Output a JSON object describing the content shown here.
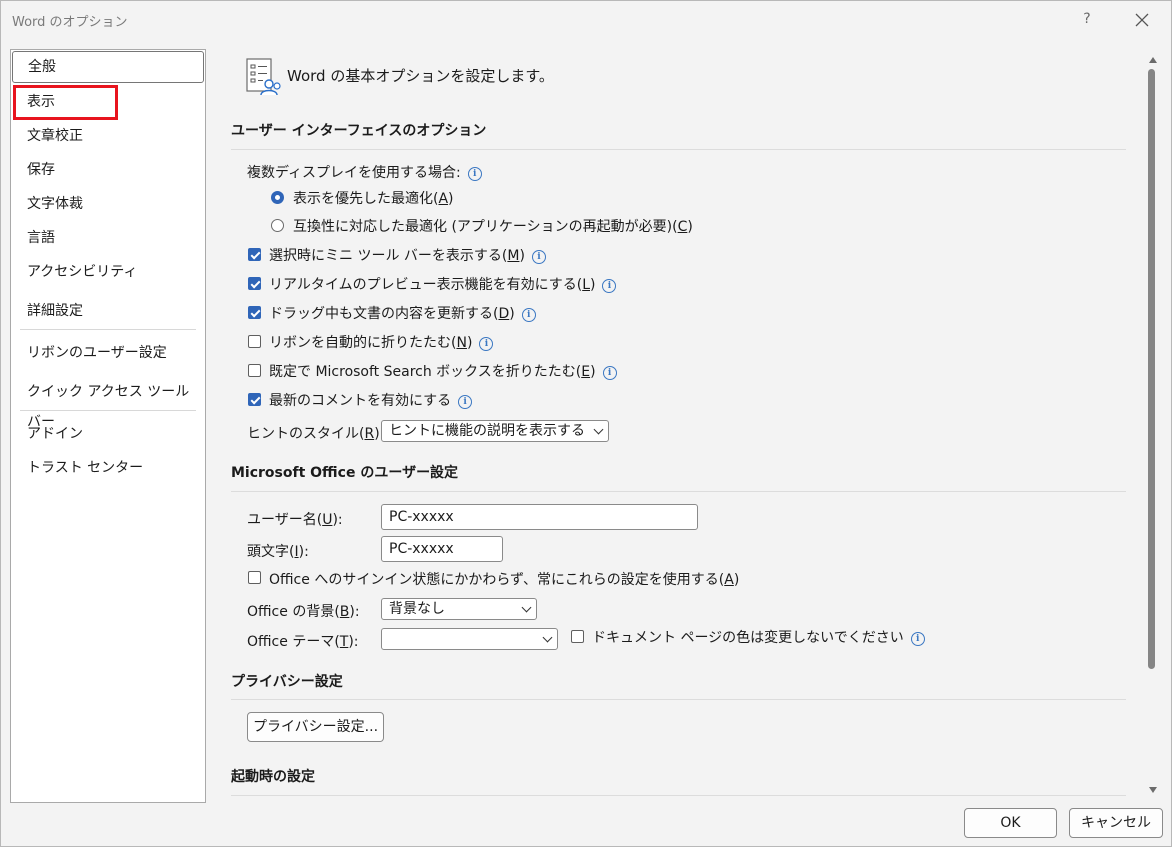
{
  "window": {
    "title": "Word のオプション",
    "help": "?"
  },
  "nav": {
    "items": [
      "全般",
      "表示",
      "文章校正",
      "保存",
      "文字体裁",
      "言語",
      "アクセシビリティ",
      "詳細設定",
      "リボンのユーザー設定",
      "クイック アクセス ツール バー",
      "アドイン",
      "トラスト センター"
    ],
    "selected": "全般",
    "highlighted": "表示"
  },
  "header": {
    "text": "Word の基本オプションを設定します。"
  },
  "sections": {
    "ui_options": "ユーザー インターフェイスのオプション",
    "user_settings": "Microsoft Office のユーザー設定",
    "privacy": "プライバシー設定",
    "startup": "起動時の設定"
  },
  "ui": {
    "multi_display_label": "複数ディスプレイを使用する場合:",
    "radio_display_pre": "表示を優先した最適化(",
    "radio_display_key": "A",
    "radio_compat_pre": "互換性に対応した最適化 (アプリケーションの再起動が必要)(",
    "radio_compat_key": "C",
    "cb_minitoolbar_pre": "選択時にミニ ツール バーを表示する(",
    "cb_minitoolbar_key": "M",
    "cb_livepreview_pre": "リアルタイムのプレビュー表示機能を有効にする(",
    "cb_livepreview_key": "L",
    "cb_dragupdate_pre": "ドラッグ中も文書の内容を更新する(",
    "cb_dragupdate_key": "D",
    "cb_collapseribbon_pre": "リボンを自動的に折りたたむ(",
    "cb_collapseribbon_key": "N",
    "cb_collapsesearch_pre": "既定で Microsoft Search ボックスを折りたたむ(",
    "cb_collapsesearch_key": "E",
    "cb_moderncomments": "最新のコメントを有効にする",
    "tooltip_label_pre": "ヒントのスタイル(",
    "tooltip_label_key": "R",
    "tooltip_value": "ヒントに機能の説明を表示する",
    "close_paren": ")",
    "close_paren_colon": "):"
  },
  "user": {
    "username_label_pre": "ユーザー名(",
    "username_label_key": "U",
    "username_value": "PC-xxxxx",
    "initials_label_pre": "頭文字(",
    "initials_label_key": "I",
    "initials_value": "PC-xxxxx",
    "always_use_pre": "Office へのサインイン状態にかかわらず、常にこれらの設定を使用する(",
    "always_use_key": "A",
    "background_label_pre": "Office の背景(",
    "background_label_key": "B",
    "background_value": "背景なし",
    "theme_label_pre": "Office テーマ(",
    "theme_label_key": "T",
    "theme_value": "",
    "no_change_page_color": "ドキュメント ページの色は変更しないでください"
  },
  "privacy": {
    "button": "プライバシー設定..."
  },
  "footer": {
    "ok": "OK",
    "cancel": "キャンセル"
  },
  "state": {
    "radio_display": true,
    "radio_compat": false,
    "cb_minitoolbar": true,
    "cb_livepreview": true,
    "cb_dragupdate": true,
    "cb_collapseribbon": false,
    "cb_collapsesearch": false,
    "cb_moderncomments": true,
    "always_use": false,
    "no_change_page_color": false
  },
  "colors": {
    "accent": "#2f65b8",
    "highlight": "#e8141e"
  },
  "icons": {
    "close": "close-icon",
    "info": "info-icon",
    "header": "options-person-icon"
  }
}
